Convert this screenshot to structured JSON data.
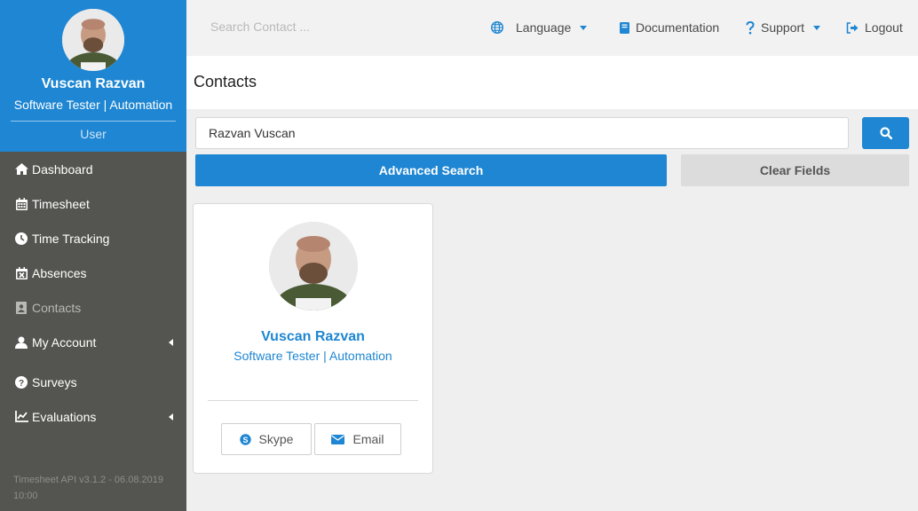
{
  "profile": {
    "name": "Vuscan Razvan",
    "role": "Software Tester | Automation",
    "role_label": "User"
  },
  "sidebar": {
    "items": [
      {
        "label": "Dashboard",
        "icon": "home-icon"
      },
      {
        "label": "Timesheet",
        "icon": "calendar-icon"
      },
      {
        "label": "Time Tracking",
        "icon": "clock-icon"
      },
      {
        "label": "Absences",
        "icon": "calendar-x-icon"
      },
      {
        "label": "Contacts",
        "icon": "contact-card-icon"
      },
      {
        "label": "My Account",
        "icon": "user-icon"
      },
      {
        "label": "Surveys",
        "icon": "question-circle-icon"
      },
      {
        "label": "Evaluations",
        "icon": "line-chart-icon"
      }
    ],
    "version": "Timesheet API v3.1.2 - 06.08.2019 10:00"
  },
  "topbar": {
    "search_placeholder": "Search Contact ...",
    "language": "Language",
    "documentation": "Documentation",
    "support": "Support",
    "logout": "Logout"
  },
  "page": {
    "title": "Contacts"
  },
  "search": {
    "value": "Razvan Vuscan",
    "advanced_label": "Advanced Search",
    "clear_label": "Clear Fields"
  },
  "contact_card": {
    "name": "Vuscan Razvan",
    "role": "Software Tester | Automation",
    "skype_label": "Skype",
    "email_label": "Email"
  },
  "colors": {
    "accent": "#1e86d2",
    "sidebar": "#545450",
    "background": "#efefef"
  }
}
